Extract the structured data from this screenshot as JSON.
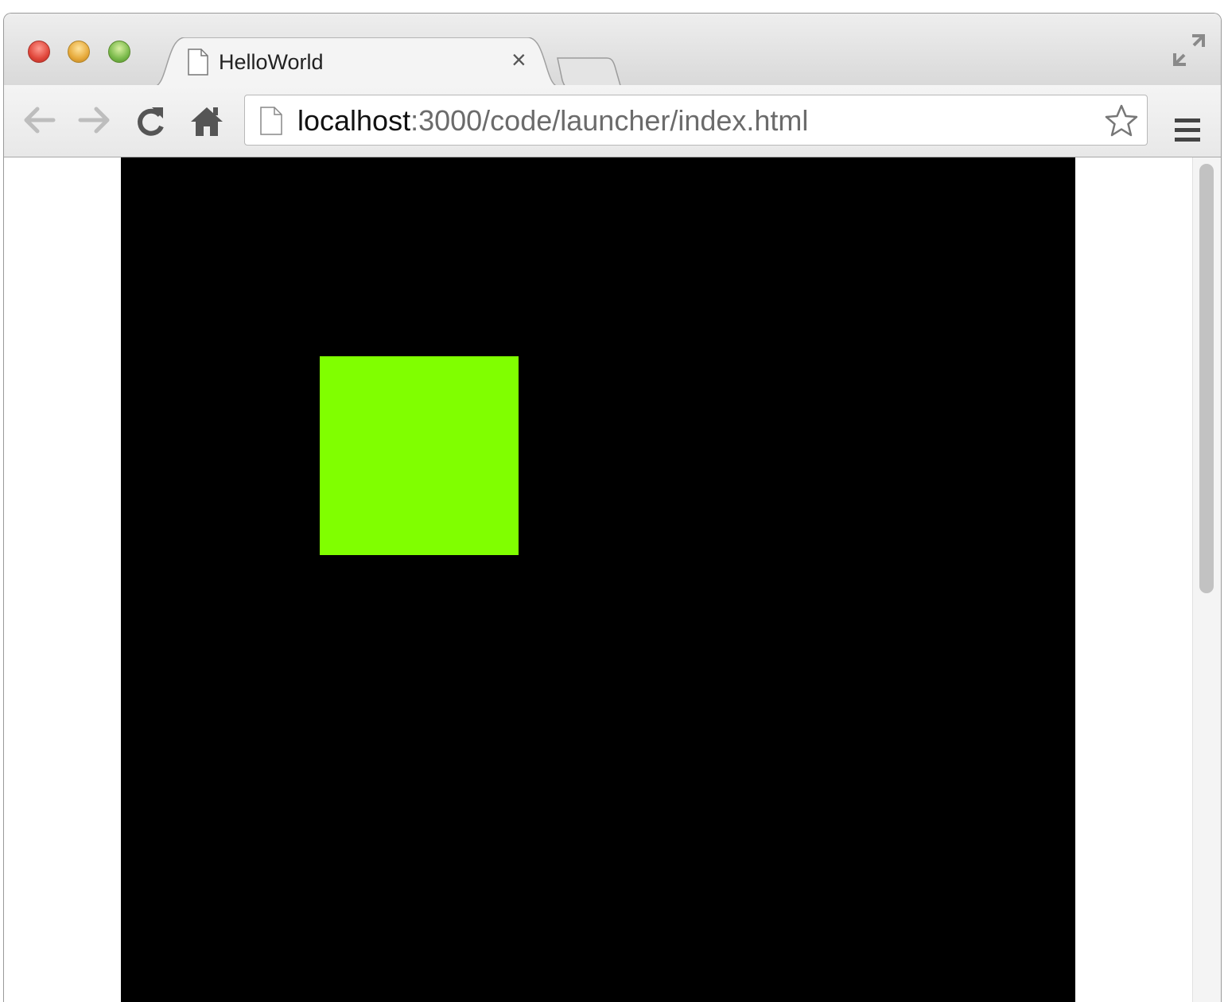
{
  "browser": {
    "tab": {
      "title": "HelloWorld",
      "close_glyph": "×",
      "icon": "document-icon"
    },
    "address_bar": {
      "url_host": "localhost",
      "url_path": ":3000/code/launcher/index.html",
      "page_icon": "document-icon",
      "bookmark_icon": "star-icon"
    },
    "toolbar": {
      "back_icon": "arrow-left-icon",
      "forward_icon": "arrow-right-icon",
      "reload_icon": "reload-icon",
      "home_icon": "home-icon",
      "menu_icon": "hamburger-menu-icon"
    }
  },
  "page": {
    "canvas_color": "#000000",
    "sprite_color": "#80ff00"
  }
}
